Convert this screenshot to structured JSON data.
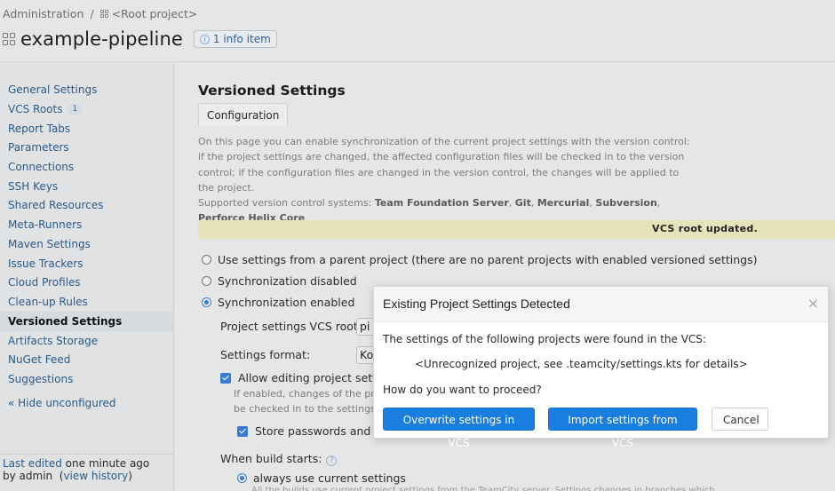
{
  "breadcrumb": {
    "root": "Administration",
    "separator": "/",
    "project": "<Root project>"
  },
  "header": {
    "title": "example-pipeline",
    "info_badge": "1 info item"
  },
  "sidebar": {
    "items": [
      {
        "label": "General Settings"
      },
      {
        "label": "VCS Roots",
        "badge": "1"
      },
      {
        "label": "Report Tabs"
      },
      {
        "label": "Parameters"
      },
      {
        "label": "Connections"
      },
      {
        "label": "SSH Keys"
      },
      {
        "label": "Shared Resources"
      },
      {
        "label": "Meta-Runners"
      },
      {
        "label": "Maven Settings"
      },
      {
        "label": "Issue Trackers"
      },
      {
        "label": "Cloud Profiles"
      },
      {
        "label": "Clean-up Rules"
      },
      {
        "label": "Versioned Settings",
        "active": true
      },
      {
        "label": "Artifacts Storage"
      },
      {
        "label": "NuGet Feed"
      },
      {
        "label": "Suggestions"
      }
    ],
    "hide_link": "« Hide unconfigured",
    "last_edited_link": "Last edited",
    "last_edited_time": " one minute ago",
    "by_user": "by admin",
    "view_history": "view history"
  },
  "main": {
    "title": "Versioned Settings",
    "tab": "Configuration",
    "description": "On this page you can enable synchronization of the current project settings with the version control: if the project settings are changed, the affected configuration files will be checked in to the version control; if the configuration files are changed in the version control, the changes will be applied to the project.",
    "supported_label": "Supported version control systems: ",
    "vcs_systems": [
      "Team Foundation Server",
      "Git",
      "Mercurial",
      "Subversion",
      "Perforce Helix Core"
    ],
    "notice": "VCS root updated.",
    "radios": [
      {
        "label": "Use settings from a parent project (there are no parent projects with enabled versioned settings)",
        "checked": false
      },
      {
        "label": "Synchronization disabled",
        "checked": false
      },
      {
        "label": "Synchronization enabled",
        "checked": true
      }
    ],
    "vcs_root_label": "Project settings VCS root:",
    "vcs_root_value": "pi",
    "format_label": "Settings format:",
    "format_value": "Ko",
    "allow_editing_label": "Allow editing project settin",
    "allow_editing_checked": true,
    "allow_hint_1": "If enabled, changes of the proj",
    "allow_hint_2": "be checked in to the settings r",
    "store_passwords_label": "Store passwords and AI",
    "store_passwords_checked": true,
    "build_starts_label": "When build starts:",
    "build_option": "always use current settings",
    "build_option_checked": true,
    "build_hint_cut": "All the builds use current project settings from the TeamCity server. Settings changes in branches which"
  },
  "modal": {
    "title": "Existing Project Settings Detected",
    "close": "×",
    "text1": "The settings of the following projects were found in the VCS:",
    "project": "<Unrecognized project, see .teamcity/settings.kts for details>",
    "question": "How do you want to proceed?",
    "buttons": {
      "overwrite": "Overwrite settings in VCS",
      "import": "Import settings from VCS",
      "cancel": "Cancel"
    }
  }
}
